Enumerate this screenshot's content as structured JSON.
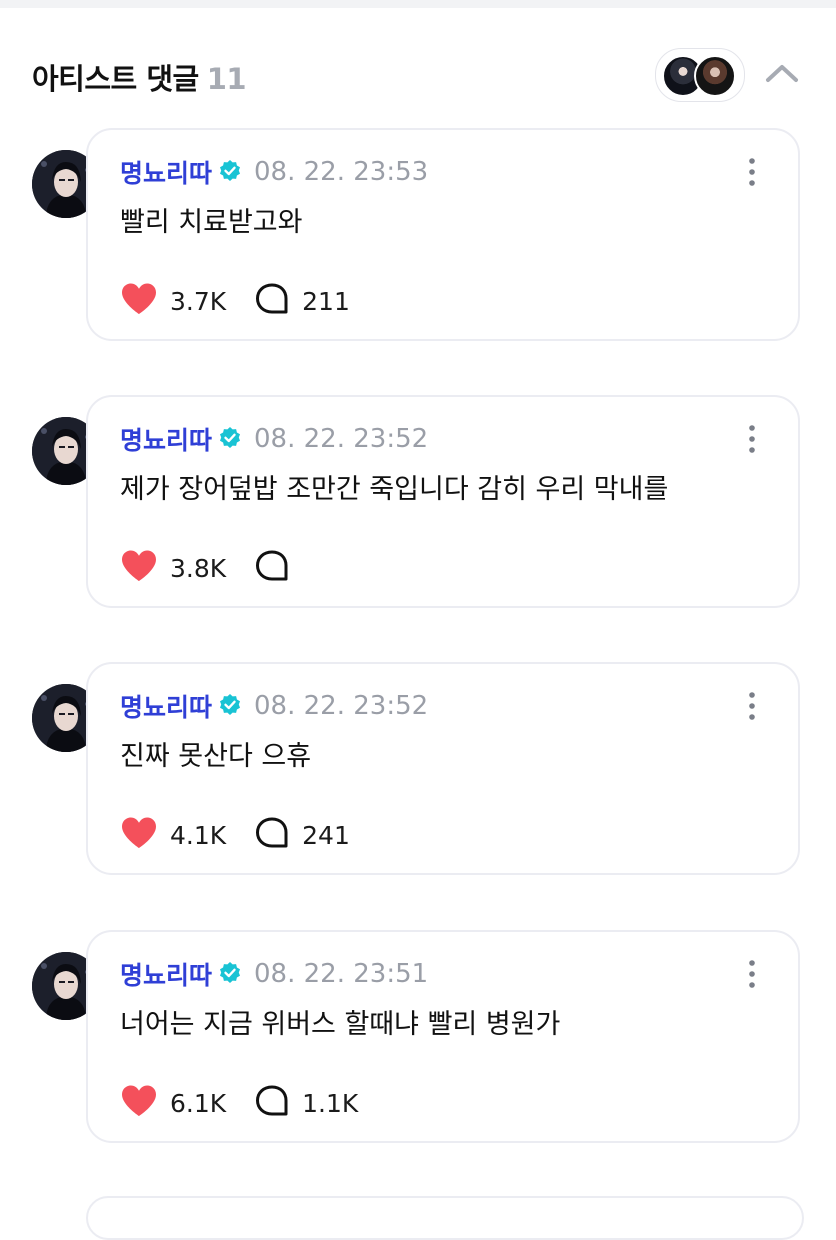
{
  "section": {
    "title": "아티스트 댓글",
    "count": "11"
  },
  "icons": {
    "verified": "verified-badge-icon",
    "like": "heart-icon",
    "reply": "comment-bubble-icon",
    "more": "more-vertical-icon",
    "collapse": "chevron-up-icon"
  },
  "colors": {
    "author": "#2f3fd6",
    "verified": "#19c3d4",
    "like": "#f4505b",
    "muted": "#9a9ea7"
  },
  "comments": [
    {
      "author": "명뇨리따",
      "time": "08. 22. 23:53",
      "text": "빨리 치료받고와",
      "likes": "3.7K",
      "replies": "211"
    },
    {
      "author": "명뇨리따",
      "time": "08. 22. 23:52",
      "text": " 제가 장어덮밥 조만간 죽입니다 감히 우리 막내를",
      "likes": "3.8K",
      "replies": ""
    },
    {
      "author": "명뇨리따",
      "time": "08. 22. 23:52",
      "text": "진짜 못산다 으휴",
      "likes": "4.1K",
      "replies": "241"
    },
    {
      "author": "명뇨리따",
      "time": "08. 22. 23:51",
      "text": "너어는 지금 위버스 할때냐 빨리 병원가",
      "likes": "6.1K",
      "replies": "1.1K"
    }
  ]
}
